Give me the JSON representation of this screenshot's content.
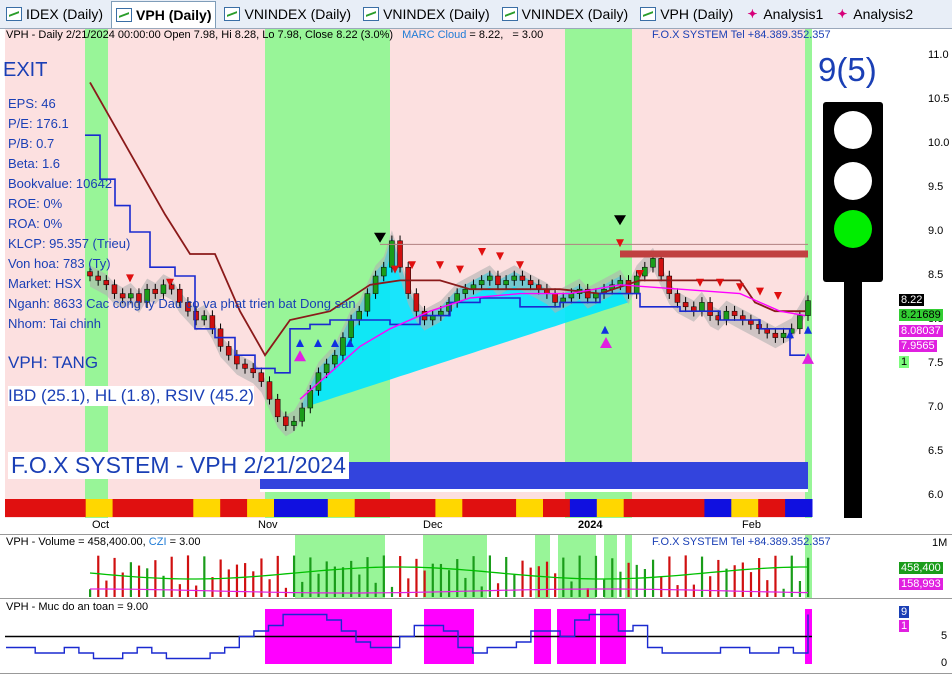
{
  "tabs": [
    {
      "label": "IDEX (Daily)",
      "icon": "chart-icon",
      "active": false
    },
    {
      "label": "VPH (Daily)",
      "icon": "chart-icon",
      "active": true
    },
    {
      "label": "VNINDEX (Daily)",
      "icon": "chart-icon",
      "active": false
    },
    {
      "label": "VNINDEX (Daily)",
      "icon": "chart-icon",
      "active": false
    },
    {
      "label": "VNINDEX (Daily)",
      "icon": "chart-icon",
      "active": false
    },
    {
      "label": "VPH (Daily)",
      "icon": "chart-icon",
      "active": false
    },
    {
      "label": "Analysis1",
      "icon": "analysis-icon",
      "active": false
    },
    {
      "label": "Analysis2",
      "icon": "analysis-icon",
      "active": false
    }
  ],
  "price_pane": {
    "header": "VPH - Daily 2/21/2024 00:00:00 Open 7.98, Hi 8.28, Lo 7.98, Close 8.22 (3.0%)",
    "cloud_label": "MARC Cloud",
    "cloud_value": "= 8.22,",
    "extra_value": "= 3.00",
    "fox_contact": "F.O.X SYSTEM Tel +84.389.352.357",
    "exit_label": "EXIT",
    "info_lines": [
      "EPS: 46",
      "P/E: 176.1",
      "P/B: 0.7",
      "Beta: 1.6",
      "Bookvalue: 10642",
      "ROE: 0%",
      "ROA: 0%",
      "KLCP: 95.357 (Trieu)",
      "Von hoa: 783 (Ty)",
      "Market: HSX",
      "Nganh: 8633 Cac cong ty Dau co va phat trien bat Dong san",
      "Nhom: Tai chinh"
    ],
    "trend_label": "VPH: TANG",
    "ibd_line": "IBD (25.1), HL (1.8), RSIV (45.2)",
    "banner": "F.O.X SYSTEM - VPH 2/21/2024",
    "signal_count": "9(5)",
    "traffic_light": {
      "top": "off",
      "middle": "off",
      "bottom": "green"
    },
    "y_ticks": [
      "11.0",
      "10.5",
      "10.0",
      "9.5",
      "9.0",
      "8.5",
      "8.0",
      "7.5",
      "7.0",
      "6.5",
      "6.0"
    ],
    "price_labels": [
      {
        "text": "8.22",
        "bg": "#000000",
        "fg": "#ffffff"
      },
      {
        "text": "8.21689",
        "bg": "#32cd32",
        "fg": "#000000"
      },
      {
        "text": "8.08037",
        "bg": "#e020e0",
        "fg": "#ffffff"
      },
      {
        "text": "7.9565",
        "bg": "#e020e0",
        "fg": "#ffffff"
      },
      {
        "text": "1",
        "bg": "#7cfc7c",
        "fg": "#000000"
      }
    ]
  },
  "x_axis": {
    "labels": [
      "Oct",
      "Nov",
      "Dec",
      "2024",
      "Feb"
    ]
  },
  "volume_pane": {
    "header_prefix": "VPH - Volume = 458,400.00,",
    "czi_label": "CZI",
    "czi_value": "= 3.00",
    "fox_contact": "F.O.X SYSTEM Tel +84.389.352.357",
    "y_tick": "1M",
    "labels": [
      {
        "text": "458,400",
        "bg": "#1a9c1a",
        "fg": "#ffffff"
      },
      {
        "text": "158,993",
        "bg": "#e020e0",
        "fg": "#ffffff"
      }
    ]
  },
  "safety_pane": {
    "header": "VPH - Muc do an toan = 9.00",
    "y_ticks": [
      "5",
      "0"
    ],
    "labels": [
      {
        "text": "9",
        "bg": "#1a3fb5",
        "fg": "#ffffff"
      },
      {
        "text": "1",
        "bg": "#e020e0",
        "fg": "#ffffff"
      }
    ]
  },
  "colors": {
    "bull_zone": "#98f598",
    "bear_zone": "#fce0e0",
    "up_candle": "#1a9c1a",
    "down_candle": "#d01010",
    "cloud": "#00e5ff",
    "stop_line": "#8b1a1a",
    "blue_line": "#1a2ad0",
    "magenta": "#ff00ff"
  }
}
